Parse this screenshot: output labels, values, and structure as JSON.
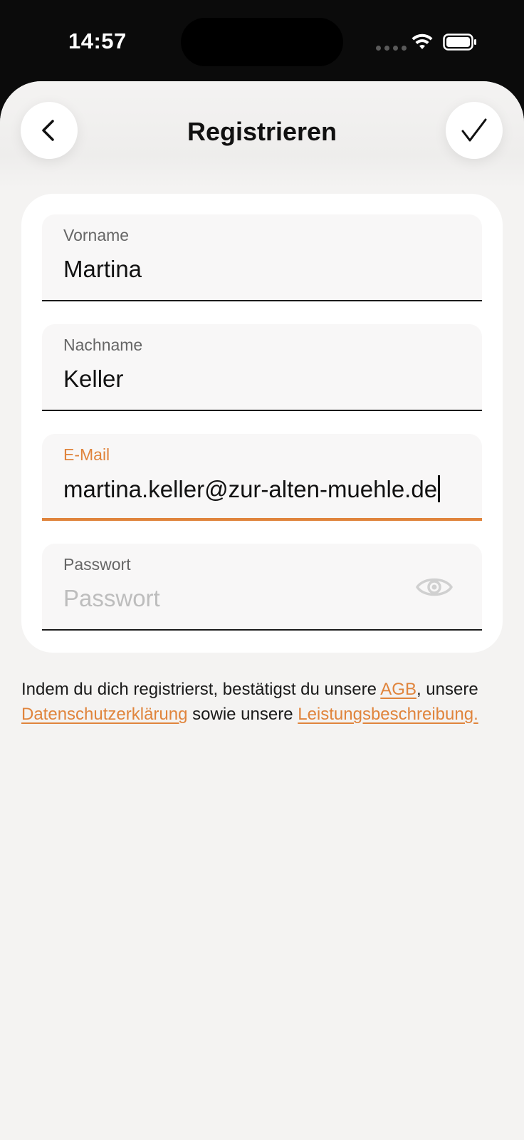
{
  "status": {
    "time": "14:57"
  },
  "header": {
    "title": "Registrieren",
    "back_icon": "chevron-left-icon",
    "confirm_icon": "checkmark-icon"
  },
  "form": {
    "first_name": {
      "label": "Vorname",
      "value": "Martina"
    },
    "last_name": {
      "label": "Nachname",
      "value": "Keller"
    },
    "email": {
      "label": "E-Mail",
      "value": "martina.keller@zur-alten-muehle.de"
    },
    "password": {
      "label": "Passwort",
      "placeholder": "Passwort",
      "value": ""
    }
  },
  "legal": {
    "part1": "Indem du dich registrierst, bestätigst du unsere ",
    "link_agb": "AGB",
    "part2": ", unsere ",
    "link_privacy": "Datenschutzerklärung",
    "part3": " sowie unsere ",
    "link_service": "Leistungsbeschreibung",
    "part4": "."
  },
  "colors": {
    "accent": "#e0843c",
    "background": "#f4f3f2",
    "card": "#ffffff",
    "text": "#111111"
  }
}
